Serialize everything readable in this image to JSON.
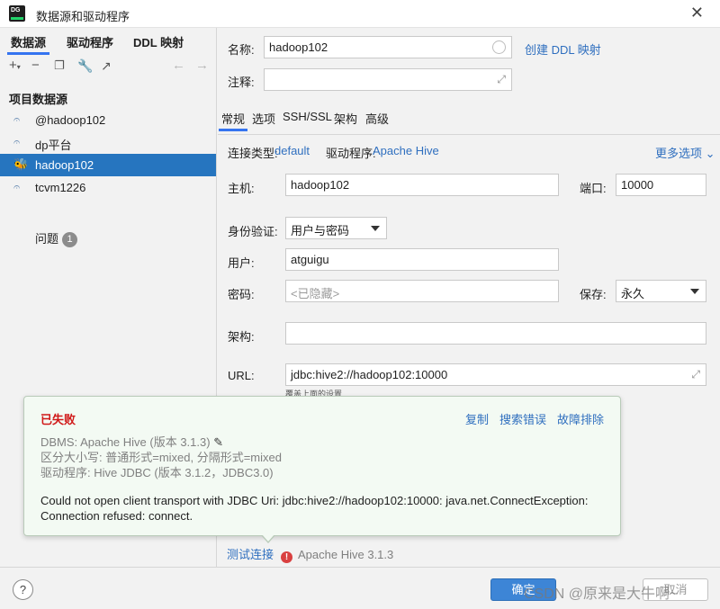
{
  "window": {
    "app_icon_text": "DG",
    "title": "数据源和驱动程序"
  },
  "left": {
    "tabs": [
      "数据源",
      "驱动程序",
      "DDL 映射"
    ],
    "group_label": "项目数据源",
    "items": [
      {
        "label": "@hadoop102"
      },
      {
        "label": "dp平台"
      },
      {
        "label": "hadoop102"
      },
      {
        "label": "tcvm1226"
      }
    ],
    "issues_label": "问题",
    "issues_count": "1"
  },
  "form": {
    "name_label": "名称:",
    "name_value": "hadoop102",
    "create_ddl_link": "创建 DDL 映射",
    "comment_label": "注释:",
    "tabs": [
      "常规",
      "选项",
      "SSH/SSL",
      "架构",
      "高级"
    ],
    "conn_type_label": "连接类型:",
    "conn_type_value": "default",
    "driver_label": "驱动程序:",
    "driver_value": "Apache Hive",
    "more_options": "更多选项",
    "host_label": "主机:",
    "host_value": "hadoop102",
    "port_label": "端口:",
    "port_value": "10000",
    "auth_label": "身份验证:",
    "auth_value": "用户与密码",
    "user_label": "用户:",
    "user_value": "atguigu",
    "password_label": "密码:",
    "password_placeholder": "<已隐藏>",
    "save_label": "保存:",
    "save_value": "永久",
    "schema_label": "架构:",
    "url_label": "URL:",
    "url_value": "jdbc:hive2://hadoop102:10000",
    "url_hint": "覆盖上面的设置"
  },
  "popup": {
    "status": "已失败",
    "links": [
      "复制",
      "搜索错误",
      "故障排除"
    ],
    "dbms": "DBMS: Apache Hive (版本 3.1.3)",
    "case": "区分大小写: 普通形式=mixed, 分隔形式=mixed",
    "driver": "驱动程序: Hive JDBC (版本 3.1.2，JDBC3.0)",
    "error_line1": "Could not open client transport with JDBC Uri: jdbc:hive2://hadoop102:10000: java.net.ConnectException:",
    "error_line2": "Connection refused: connect."
  },
  "status": {
    "test_connection": "测试连接",
    "error_mark": "!",
    "version": "Apache Hive 3.1.3"
  },
  "buttons": {
    "help": "?",
    "ok": "确定",
    "cancel": "取消"
  },
  "watermark": "CSDN @原来是大牛啊~"
}
